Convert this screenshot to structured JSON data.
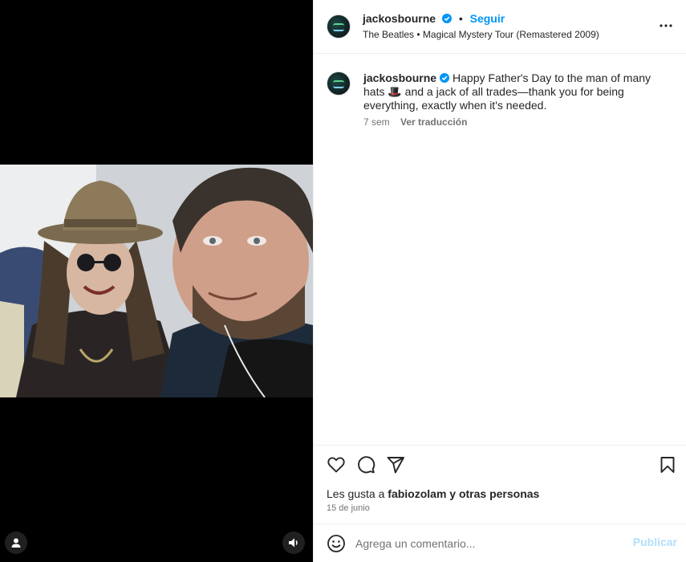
{
  "post": {
    "username": "jackosbourne",
    "follow_label": "Seguir",
    "separator": "•",
    "music": "The Beatles • Magical Mystery Tour (Remastered 2009)"
  },
  "caption": {
    "username": "jackosbourne",
    "text": "Happy Father's Day to the man of many hats 🎩 and a jack of all trades—thank you for being everything, exactly when it's needed.",
    "age": "7 sem",
    "translate_label": "Ver traducción"
  },
  "engagement": {
    "likes_prefix": "Les gusta a",
    "liked_by": "fabiozolam",
    "likes_suffix": "y otras personas",
    "date": "15 de junio"
  },
  "comment_box": {
    "placeholder": "Agrega un comentario...",
    "publish_label": "Publicar"
  },
  "icons": {
    "verified": "verified-badge-icon",
    "more": "more-options-icon",
    "like": "heart-icon",
    "comment": "comment-icon",
    "share": "share-icon",
    "save": "bookmark-icon",
    "emoji": "emoji-icon",
    "user_tags": "user-tag-icon",
    "audio": "audio-icon"
  },
  "colors": {
    "accent": "#0095f6",
    "publish_disabled": "#b2dffc",
    "secondary_text": "#737373"
  }
}
